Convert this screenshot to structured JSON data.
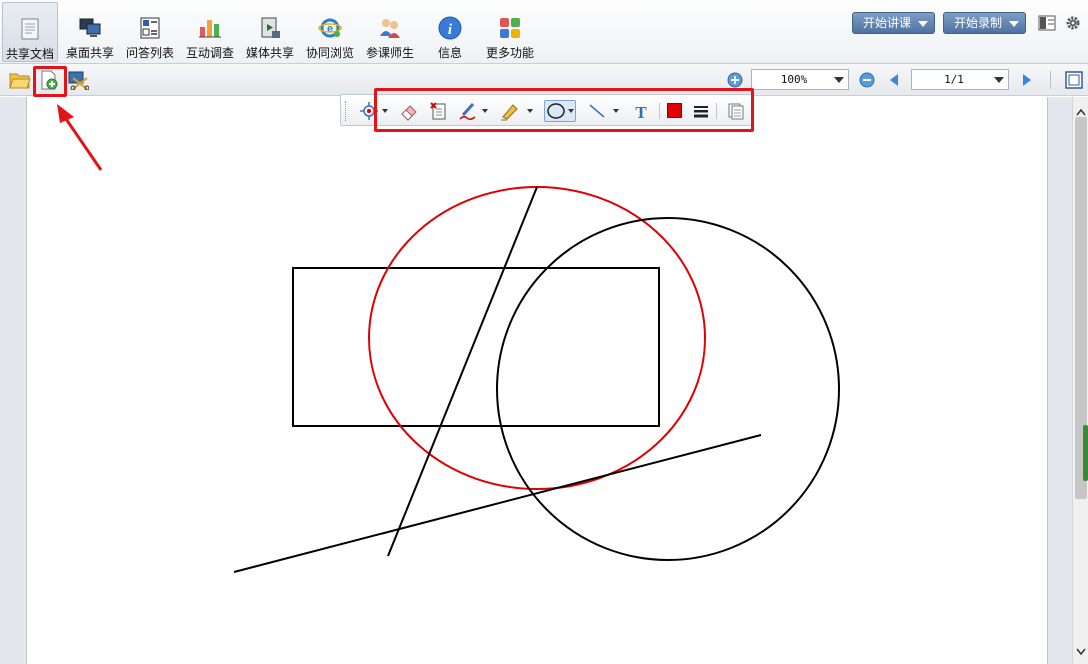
{
  "toolbar": {
    "items": [
      {
        "label": "共享文档",
        "icon": "document-icon"
      },
      {
        "label": "桌面共享",
        "icon": "desktop-share-icon"
      },
      {
        "label": "问答列表",
        "icon": "qa-icon"
      },
      {
        "label": "互动调查",
        "icon": "survey-chart-icon"
      },
      {
        "label": "媒体共享",
        "icon": "media-share-icon"
      },
      {
        "label": "协同浏览",
        "icon": "co-browse-icon"
      },
      {
        "label": "参课师生",
        "icon": "participants-icon"
      },
      {
        "label": "信息",
        "icon": "info-icon"
      },
      {
        "label": "更多功能",
        "icon": "more-functions-icon"
      }
    ],
    "start_lecture": "开始讲课",
    "start_record": "开始录制"
  },
  "subbar": {
    "zoom": "100%",
    "page": "1/1"
  },
  "colors": {
    "highlight": "#e3131a",
    "pen_color": "#e00000"
  }
}
